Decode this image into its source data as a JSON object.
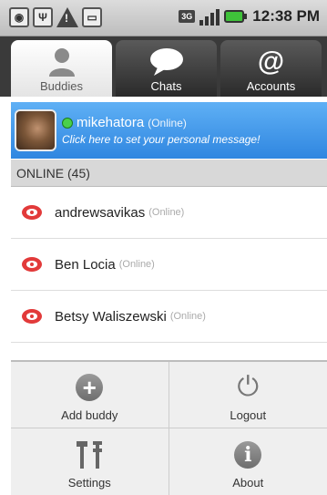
{
  "statusbar": {
    "network_type": "3G",
    "time": "12:38 PM"
  },
  "tabs": [
    {
      "label": "Buddies",
      "icon": "person-icon",
      "active": true
    },
    {
      "label": "Chats",
      "icon": "speech-bubble-icon",
      "active": false
    },
    {
      "label": "Accounts",
      "icon": "at-sign-icon",
      "active": false
    }
  ],
  "profile": {
    "name": "mikehatora",
    "status": "(Online)",
    "message": "Click here to set your personal message!"
  },
  "section_header": "ONLINE (45)",
  "buddies": [
    {
      "name": "andrewsavikas",
      "status": "(Online)"
    },
    {
      "name": "Ben Locia",
      "status": "(Online)"
    },
    {
      "name": "Betsy Waliszewski",
      "status": "(Online)"
    }
  ],
  "menu": {
    "add_buddy": "Add buddy",
    "logout": "Logout",
    "settings": "Settings",
    "about": "About"
  },
  "colors": {
    "accent": "#2f86e0",
    "online": "#4ad04a",
    "aim_red": "#e23a3a"
  }
}
